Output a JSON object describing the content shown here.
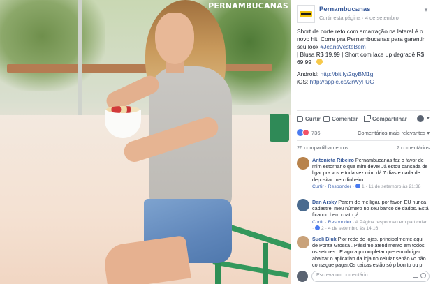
{
  "photo": {
    "watermark": "PERNAMBUCANAS"
  },
  "post": {
    "page_name": "Pernambucanas",
    "page_action": "Curtir esta página",
    "separator": " · ",
    "date": "4 de setembro",
    "text_lines": [
      "Short de corte reto com amarração na lateral é o",
      "novo hit. Corre pra Pernambucanas para garantir",
      "seu look ",
      "| Blusa R$ 19,99 | Short com lace up degradê R$",
      "69,99 | "
    ],
    "hashtag": "#JeansVesteBem",
    "android_label": "Android: ",
    "android_url": "http://bit.ly/2qyBM1g",
    "ios_label": "iOS: ",
    "ios_url": "http://apple.co/2rWyFUG"
  },
  "actions": {
    "like": "Curtir",
    "comment": "Comentar",
    "share": "Compartilhar"
  },
  "stats": {
    "reactions_count": "736",
    "sort_label": "Comentários mais relevantes",
    "shares": "26 compartilhamentos",
    "comments": "7 comentários"
  },
  "comments": [
    {
      "name": "Antonieta Ribeiro",
      "text": "Pernambucanas faz o favor de mim estornar o que mim deve! Já estou cansada de ligar pra vcs e toda vez mim dá 7 dias e nada de depositar meu dinheiro.",
      "like": "Curtir",
      "reply": "Responder",
      "likes": "1",
      "time": "11 de setembro às 21:38",
      "avatar_color": "#b8834c"
    },
    {
      "name": "Dan Arsky",
      "text": "Parem de me ligar, por favor. EU nunca cadastrei meu número no seu banco de dados. Está ficando bem chato já",
      "like": "Curtir",
      "reply": "Responder",
      "page_replied": "A Página respondeu em particular",
      "likes": "2",
      "time": "4 de setembro às 14:16",
      "avatar_color": "#4a6b8f"
    },
    {
      "name": "Sueli Bluk",
      "text": "Pior rede de lojas, principalmente aqui de Ponta Grossa . Péssimo atendimento em todos os setores . E agora p completar querem obrigar abaixar o aplicativo da loja no celular senão vc não consegue pagar.Os caixas estão só p bonito ou p",
      "avatar_color": "#c9a27a"
    }
  ],
  "reply_box": {
    "placeholder": "Escreva um comentário..."
  },
  "colors": {
    "link": "#365899",
    "accent": "#4267b2",
    "muted": "#90949c"
  },
  "icons": [
    "like-icon",
    "comment-icon",
    "share-icon",
    "chevron-down-icon",
    "camera-icon",
    "emoji-icon"
  ]
}
